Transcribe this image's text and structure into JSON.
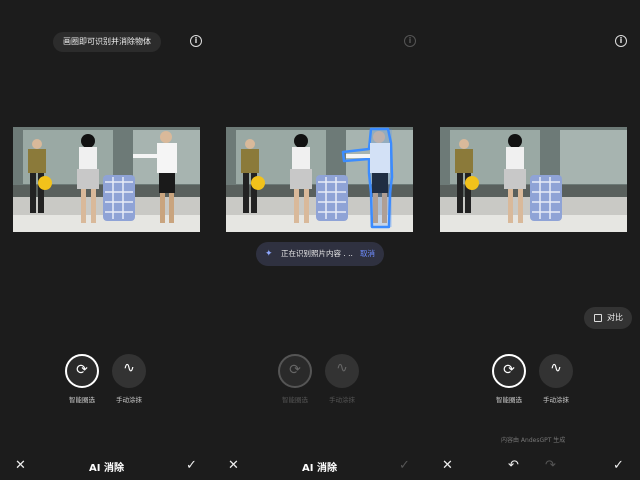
{
  "hint": "画圈即可识别并消除物体",
  "info_icon": "i",
  "toast": {
    "message": "正在识别照片内容",
    "dots": ". ..",
    "cancel": "取消"
  },
  "compare": {
    "label": "对比"
  },
  "tools": {
    "smart": "智能圈选",
    "manual": "手动涂抹"
  },
  "ai_note": "内容由 AndesGPT 生成",
  "bottom": {
    "close": "✕",
    "title": "AI 消除",
    "confirm": "✓",
    "undo": "↶",
    "redo": "↷"
  },
  "colors": {
    "background": "#1c1c1c",
    "highlight": "#3b8cff",
    "accent": "#6f8dff"
  }
}
